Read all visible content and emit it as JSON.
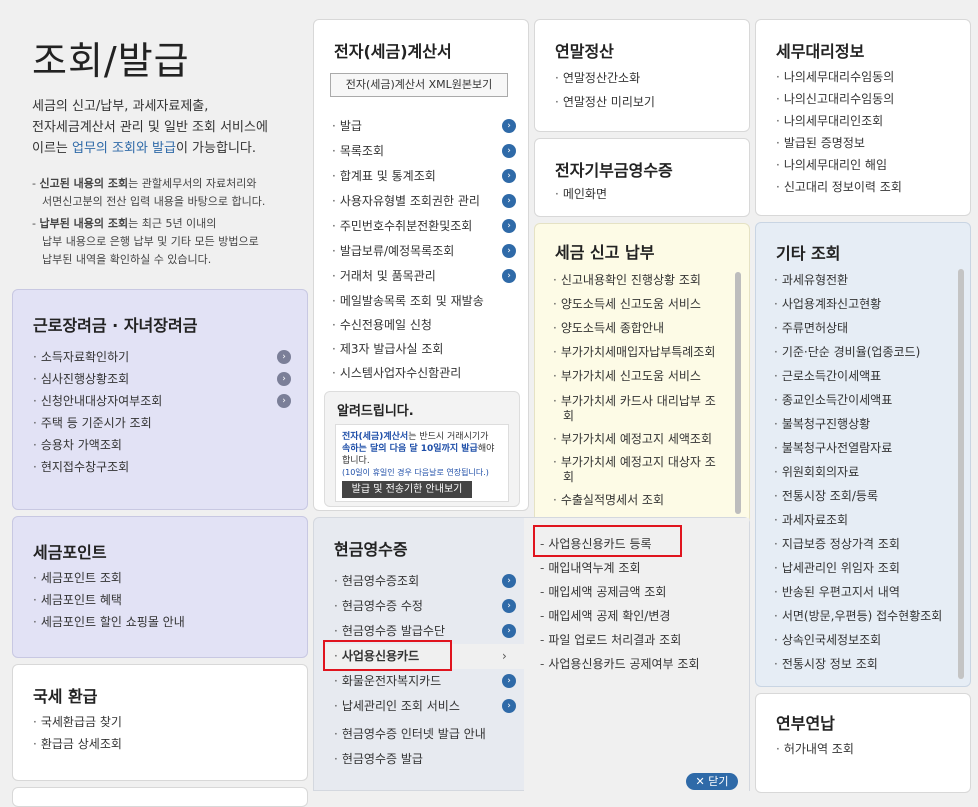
{
  "intro": {
    "title": "조회/발급",
    "desc1": "세금의 신고/납부, 과세자료제출,",
    "desc2": "전자세금계산서 관리 및 일반 조회 서비스에",
    "desc3_pre": "이르는 ",
    "desc3_link": "업무의 조회와 발급",
    "desc3_post": "이 가능합니다.",
    "note1_bold": "신고된 내용의 조회",
    "note1_rest": "는 관할세무서의 자료처리와",
    "note1_line2": "서면신고분의 전산 입력 내용을 바탕으로 합니다.",
    "note2_bold": "납부된 내용의 조회",
    "note2_rest": "는 최근 5년 이내의",
    "note2_line2": "납부 내용으로 은행 납부 및 기타 모든 방법으로",
    "note2_line3": "납부된 내역을 확인하실 수 있습니다."
  },
  "labor": {
    "title": "근로장려금 · 자녀장려금",
    "items": [
      "소득자료확인하기",
      "심사진행상황조회",
      "신청안내대상자여부조회",
      "주택 등 기준시가 조회",
      "승용차 가액조회",
      "현지접수창구조회"
    ]
  },
  "point": {
    "title": "세금포인트",
    "items": [
      "세금포인트 조회",
      "세금포인트 혜택",
      "세금포인트 할인 쇼핑몰 안내"
    ]
  },
  "refund": {
    "title": "국세 환급",
    "items": [
      "국세환급금 찾기",
      "환급금 상세조회"
    ]
  },
  "einvoice": {
    "title": "전자(세금)계산서",
    "xml_button": "전자(세금)계산서 XML원본보기",
    "items": [
      "발급",
      "목록조회",
      "합계표 및 통계조회",
      "사용자유형별 조회권한 관리",
      "주민번호수취분전환및조회",
      "발급보류/예정목록조회",
      "거래처 및 품목관리",
      "메일발송목록 조회 및 재발송",
      "수신전용메일 신청",
      "제3자 발급사실 조회",
      "시스템사업자수신함관리"
    ],
    "notice": {
      "title": "알려드립니다.",
      "line1_red": "전자(세금)계산서",
      "line1_rest": "는 반드시 거래시기가",
      "line2_red": "속하는 달의 다음 달 10일까지 발급",
      "line2_rest": "해야",
      "line3": "합니다.",
      "line4": "(10일이 휴일인 경우 다음날로 연장됩니다.)",
      "button": "발급 및 전송기한 안내보기"
    }
  },
  "yearend": {
    "title": "연말정산",
    "items": [
      "연말정산간소화",
      "연말정산 미리보기"
    ]
  },
  "donation": {
    "title": "전자기부금영수증",
    "items": [
      "메인화면"
    ]
  },
  "filing": {
    "title": "세금 신고 납부",
    "items": [
      "신고내용확인 진행상황 조회",
      "양도소득세 신고도움 서비스",
      "양도소득세 종합안내",
      "부가가치세매입자납부특례조회",
      "부가가치세 신고도움 서비스",
      "부가가치세 카드사 대리납부 조",
      "회",
      "부가가치세 예정고지 세액조회",
      "부가가치세 예정고지 대상자 조",
      "회",
      "수출실적명세서 조회"
    ]
  },
  "agent": {
    "title": "세무대리정보",
    "items": [
      "나의세무대리수임동의",
      "나의신고대리수임동의",
      "나의세무대리인조회",
      "발급된 증명정보",
      "나의세무대리인 해임",
      "신고대리 정보이력 조회"
    ]
  },
  "other": {
    "title": "기타 조회",
    "items": [
      "과세유형전환",
      "사업용계좌신고현황",
      "주류면허상태",
      "기준·단순 경비율(업종코드)",
      "근로소득간이세액표",
      "종교인소득간이세액표",
      "불복청구진행상황",
      "불복청구사전열람자료",
      "위원회회의자료",
      "전통시장 조회/등록",
      "과세자료조회",
      "지급보증 정상가격 조회",
      "납세관리인 위임자 조회",
      "반송된 우편고지서 내역",
      "서면(방문,우편등) 접수현황조회",
      "상속인국세정보조회",
      "전통시장 정보 조회"
    ]
  },
  "yeonbu": {
    "title": "연부연납",
    "items": [
      "허가내역 조회"
    ]
  },
  "cash": {
    "title": "현금영수증",
    "items": [
      "현금영수증조회",
      "현금영수증 수정",
      "현금영수증 발급수단",
      "사업용신용카드",
      "화물운전자복지카드",
      "납세관리인 조회 서비스",
      "현금영수증 인터넷 발급 안내",
      "현금영수증 발급"
    ],
    "sub_items": [
      "사업용신용카드 등록",
      "매입내역누계 조회",
      "매입세액 공제금액 조회",
      "매입세액 공제 확인/변경",
      "파일 업로드 처리결과 조회",
      "사업용신용카드 공제여부 조회"
    ],
    "close_label": "닫기"
  }
}
